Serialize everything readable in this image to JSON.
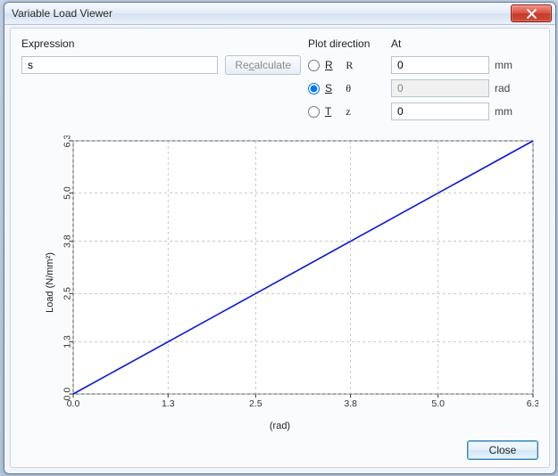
{
  "window": {
    "title": "Variable Load Viewer"
  },
  "labels": {
    "expression": "Expression",
    "plot_direction": "Plot direction",
    "at": "At"
  },
  "expression": {
    "value": "s"
  },
  "buttons": {
    "recalculate_html": "Re<span class='mnemonic'>c</span>alculate",
    "close": "Close"
  },
  "directions": [
    {
      "key": "R",
      "mnemonic": "R",
      "symbol": "R",
      "checked": false,
      "at_value": "0",
      "unit": "mm",
      "disabled": false
    },
    {
      "key": "S",
      "mnemonic": "S",
      "symbol": "θ",
      "checked": true,
      "at_value": "0",
      "unit": "rad",
      "disabled": true
    },
    {
      "key": "T",
      "mnemonic": "T",
      "symbol": "z",
      "checked": false,
      "at_value": "0",
      "unit": "mm",
      "disabled": false
    }
  ],
  "chart_data": {
    "type": "line",
    "title": "",
    "xlabel": "(rad)",
    "ylabel": "Load (N/mm²)",
    "xlim": [
      0.0,
      6.3
    ],
    "ylim": [
      0.0,
      6.3
    ],
    "xticks": [
      0.0,
      1.3,
      2.5,
      3.8,
      5.0,
      6.3
    ],
    "yticks": [
      0.0,
      1.3,
      2.5,
      3.8,
      5.0,
      6.3
    ],
    "series": [
      {
        "name": "Load",
        "color": "#0a17d6",
        "x": [
          0.0,
          1.3,
          2.5,
          3.8,
          5.0,
          6.3
        ],
        "y": [
          0.0,
          1.3,
          2.5,
          3.8,
          5.0,
          6.3
        ]
      }
    ]
  }
}
